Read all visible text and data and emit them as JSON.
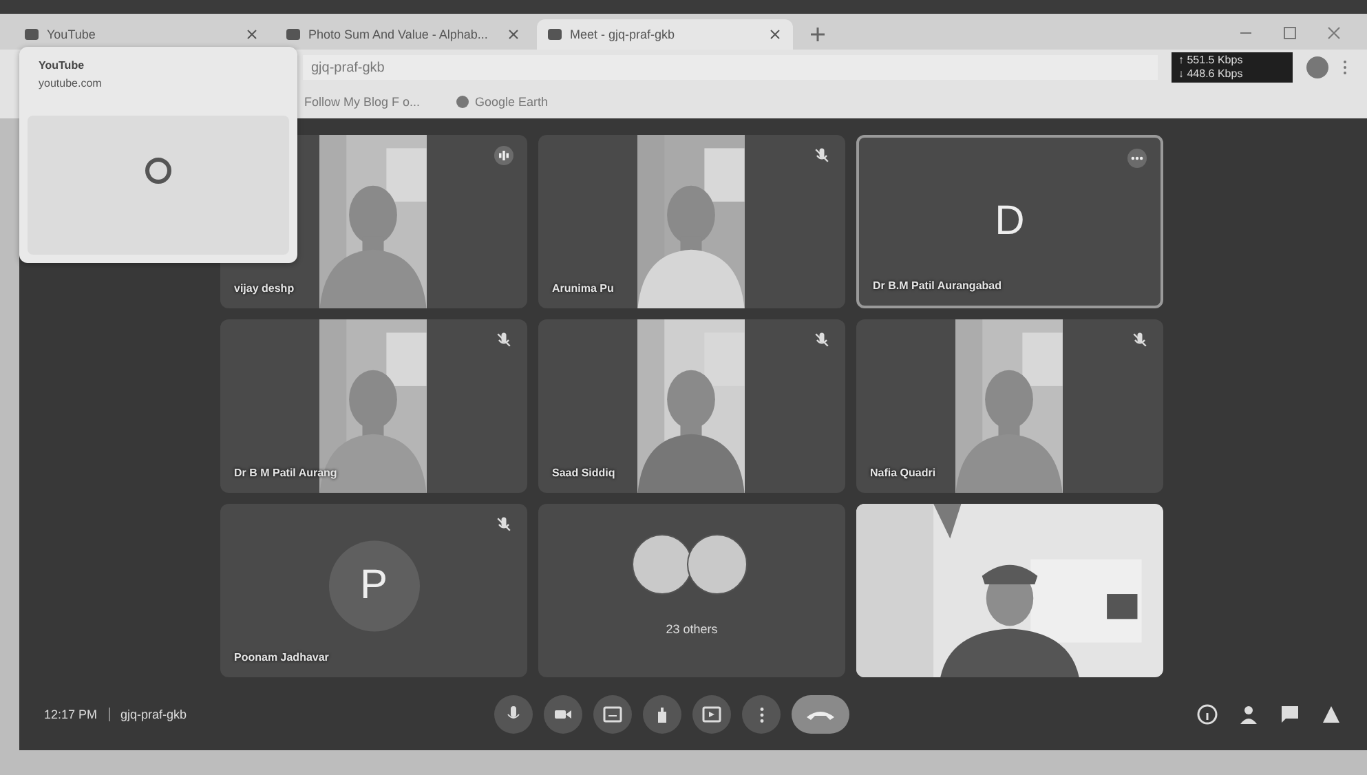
{
  "browser": {
    "tabs": [
      {
        "title": "YouTube",
        "selected": false
      },
      {
        "title": "Photo Sum And Value - Alphab...",
        "selected": false
      },
      {
        "title": "Meet - gjq-praf-gkb",
        "selected": true
      }
    ],
    "address": "gjq-praf-gkb",
    "bookmarks": [
      "Follow My Blog F o...",
      "Google Earth"
    ],
    "network": {
      "upload": "↑ 551.5 Kbps",
      "download": "↓ 448.6 Kbps"
    },
    "hover_card": {
      "title": "YouTube",
      "url": "youtube.com"
    }
  },
  "participants": [
    {
      "kind": "video",
      "name": "vijay deshp",
      "speaking": true,
      "muted": false,
      "outlined": false
    },
    {
      "kind": "video",
      "name": "Arunima Pu",
      "speaking": false,
      "muted": true,
      "outlined": false
    },
    {
      "kind": "avatar",
      "name": "Dr B.M Patil Aurangabad",
      "initial": "D",
      "speaking": false,
      "muted": false,
      "outlined": true
    },
    {
      "kind": "video",
      "name": "Dr B M Patil Aurang",
      "speaking": false,
      "muted": true,
      "outlined": false
    },
    {
      "kind": "video",
      "name": "Saad Siddiq",
      "speaking": false,
      "muted": true,
      "outlined": false
    },
    {
      "kind": "video",
      "name": "Nafia Quadri",
      "speaking": false,
      "muted": true,
      "outlined": false
    },
    {
      "kind": "avatar",
      "name": "Poonam Jadhavar",
      "initial": "P",
      "speaking": false,
      "muted": true,
      "outlined": false
    },
    {
      "kind": "others",
      "name": "23 others",
      "outlined": false
    },
    {
      "kind": "self"
    }
  ],
  "footer": {
    "time": "12:17 PM",
    "meeting_code": "gjq-praf-gkb"
  }
}
